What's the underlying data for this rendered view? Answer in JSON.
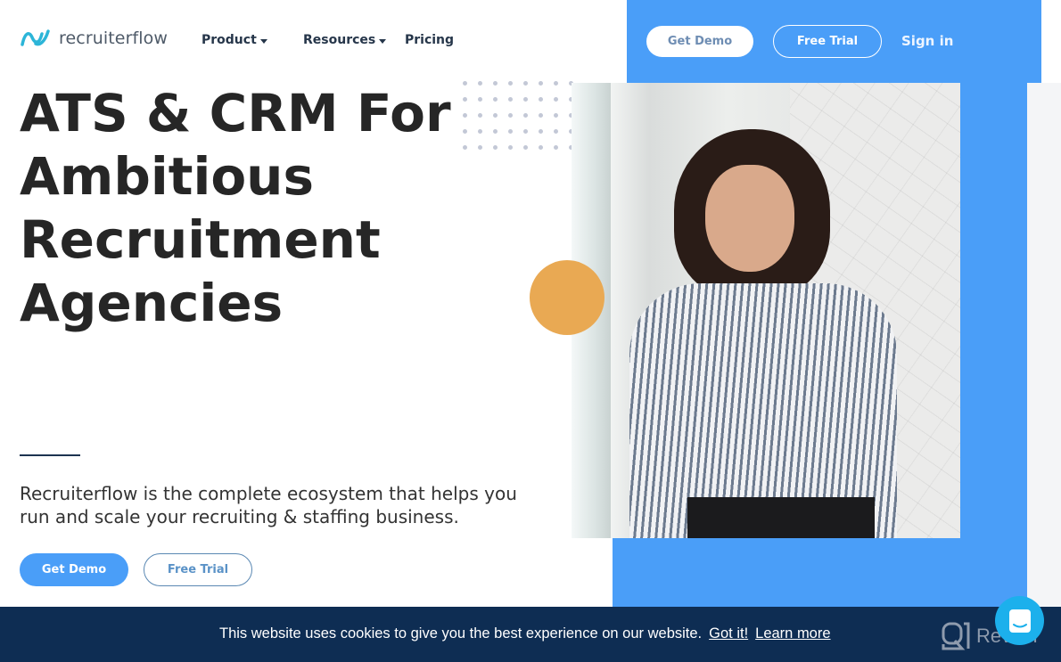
{
  "brand": {
    "name": "recruiterflow",
    "accent_color": "#4a9ef8",
    "logo_color": "#2cb5d8"
  },
  "nav": {
    "items": [
      {
        "label": "Product",
        "has_dropdown": true
      },
      {
        "label": "Resources",
        "has_dropdown": true
      },
      {
        "label": "Pricing",
        "has_dropdown": false
      }
    ],
    "get_demo_label": "Get Demo",
    "free_trial_label": "Free Trial",
    "sign_in_label": "Sign in"
  },
  "hero": {
    "title": "ATS & CRM For Ambitious Recruitment Agencies",
    "subtitle": "Recruiterflow is the complete ecosystem that helps you run and scale your recruiting & staffing business.",
    "primary_cta": "Get Demo",
    "secondary_cta": "Free Trial",
    "image_alt": "woman-in-striped-shirt-arms-crossed",
    "decor_circle_color": "#e9a953"
  },
  "cookie_banner": {
    "message": "This website uses cookies to give you the best experience on our website.",
    "accept_label": "Got it!",
    "learn_more_label": "Learn more",
    "background_color": "#0e2d53"
  },
  "watermark": {
    "label": "Revain"
  },
  "chat_widget": {
    "icon": "chat-icon"
  }
}
